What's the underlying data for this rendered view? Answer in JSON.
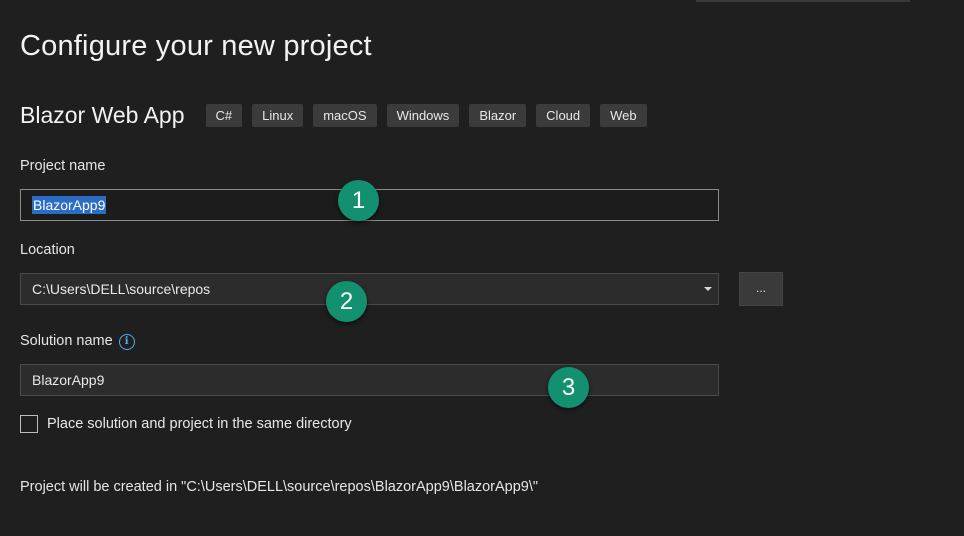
{
  "page": {
    "title": "Configure your new project"
  },
  "template": {
    "name": "Blazor Web App",
    "tags": [
      "C#",
      "Linux",
      "macOS",
      "Windows",
      "Blazor",
      "Cloud",
      "Web"
    ]
  },
  "project_name": {
    "label": "Project name",
    "value": "BlazorApp9"
  },
  "location": {
    "label": "Location",
    "value": "C:\\Users\\DELL\\source\\repos",
    "browse_label": "..."
  },
  "solution_name": {
    "label": "Solution name",
    "info_icon": "info-icon",
    "value": "BlazorApp9"
  },
  "same_directory": {
    "label": "Place solution and project in the same directory",
    "checked": false
  },
  "footer": {
    "note": "Project will be created in \"C:\\Users\\DELL\\source\\repos\\BlazorApp9\\BlazorApp9\\\""
  },
  "annotations": {
    "step1": "1",
    "step2": "2",
    "step3": "3"
  },
  "colors": {
    "background": "#1f1f1f",
    "selection": "#2b6cc4",
    "badge": "#12906f",
    "info": "#56a8f5"
  }
}
